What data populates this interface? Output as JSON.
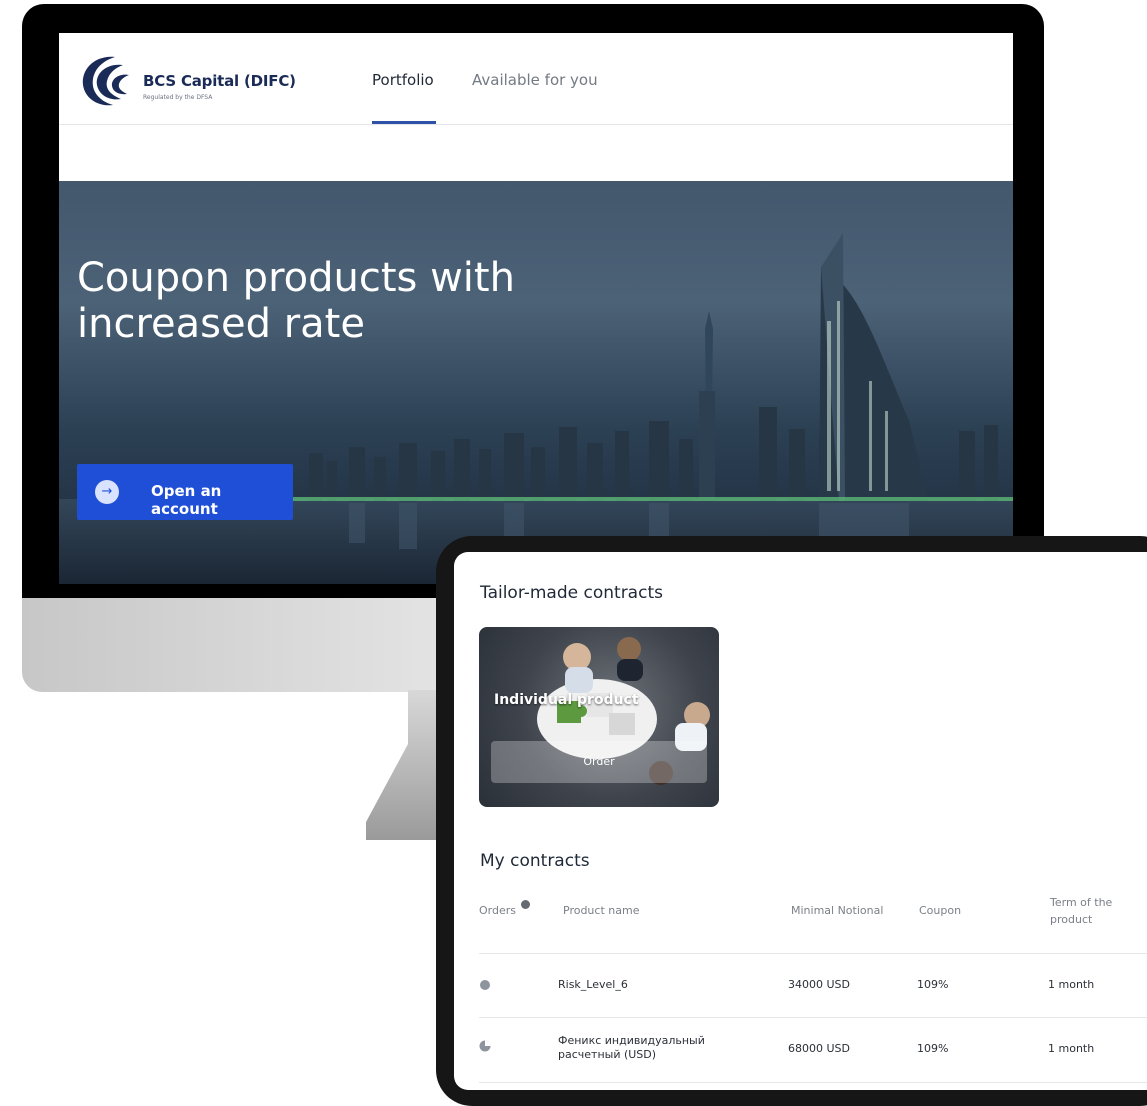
{
  "brand": {
    "name": "BCS Capital (DIFC)",
    "tagline": "Regulated by the DFSA",
    "accent_color": "#1f4fd6",
    "logo_color": "#1b2b57"
  },
  "nav": {
    "tabs": [
      {
        "label": "Portfolio",
        "active": true
      },
      {
        "label": "Available for you",
        "active": false
      }
    ]
  },
  "hero": {
    "title": "Coupon products with increased rate",
    "button_label": "Open an account",
    "button_icon": "arrow-right-icon"
  },
  "tablet": {
    "tailor_title": "Tailor-made contracts",
    "card": {
      "title": "Individual product",
      "button_label": "Order"
    },
    "contracts_title": "My contracts",
    "columns": [
      "Orders",
      "Product name",
      "Minimal Notional",
      "Coupon",
      "Term of the product"
    ],
    "rows": [
      {
        "status": "full",
        "product": "Risk_Level_6",
        "notional": "34000 USD",
        "coupon": "109%",
        "term": "1 month"
      },
      {
        "status": "partial",
        "product": "Феникс индивидуальный расчетный (USD)",
        "notional": "68000 USD",
        "coupon": "109%",
        "term": "1 month"
      }
    ]
  }
}
